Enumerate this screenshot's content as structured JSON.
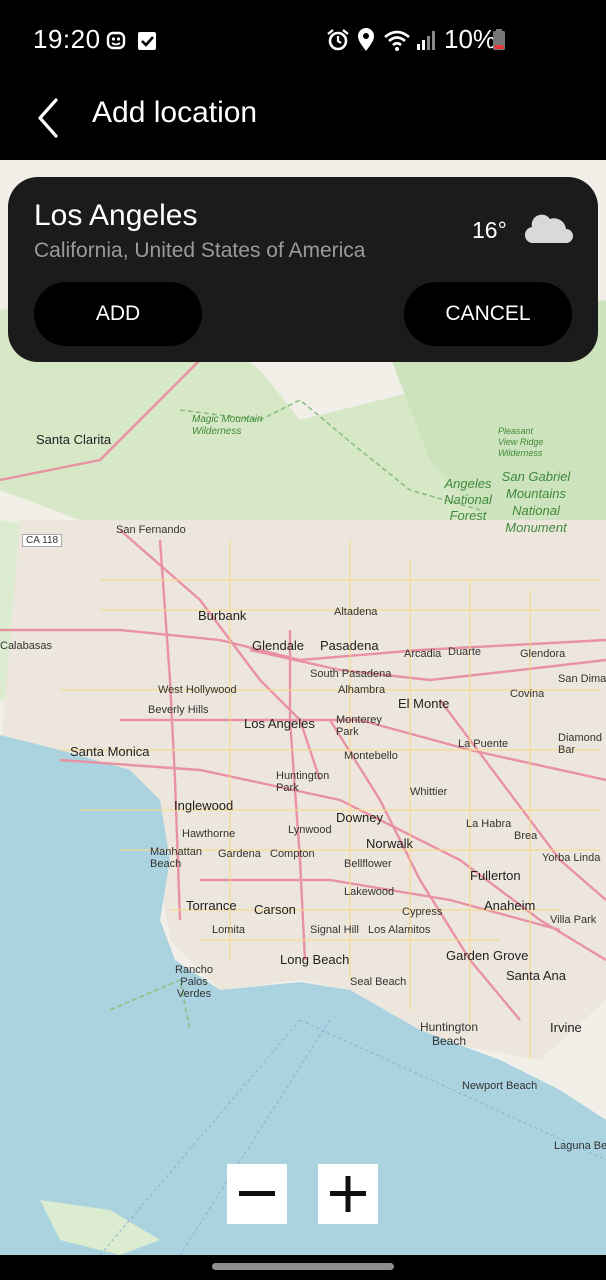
{
  "status_bar": {
    "time": "19:20",
    "battery": "10%",
    "icons": [
      "notification-icon",
      "task-icon",
      "alarm-icon",
      "location-icon",
      "wifi-icon",
      "signal-icon",
      "battery-icon"
    ]
  },
  "app_bar": {
    "back_icon": "back-arrow-icon",
    "title": "Add location"
  },
  "location_card": {
    "city": "Los Angeles",
    "region": "California, United States of America",
    "temperature": "16°",
    "weather_icon": "cloud-icon",
    "add_label": "ADD",
    "cancel_label": "CANCEL"
  },
  "map": {
    "labels": [
      {
        "text": "Santa Clarita"
      },
      {
        "text": "San Fernando"
      },
      {
        "text": "CA 118"
      },
      {
        "text": "Burbank"
      },
      {
        "text": "Glendale"
      },
      {
        "text": "Pasadena"
      },
      {
        "text": "Altadena"
      },
      {
        "text": "Arcadia"
      },
      {
        "text": "Duarte"
      },
      {
        "text": "Glendora"
      },
      {
        "text": "San Dimas"
      },
      {
        "text": "South Pasadena"
      },
      {
        "text": "West Hollywood"
      },
      {
        "text": "Beverly Hills"
      },
      {
        "text": "Alhambra"
      },
      {
        "text": "El Monte"
      },
      {
        "text": "Covina"
      },
      {
        "text": "Los Angeles"
      },
      {
        "text": "Monterey Park"
      },
      {
        "text": "Santa Monica"
      },
      {
        "text": "Montebello"
      },
      {
        "text": "La Puente"
      },
      {
        "text": "Diamond Bar"
      },
      {
        "text": "Huntington Park"
      },
      {
        "text": "Whittier"
      },
      {
        "text": "Inglewood"
      },
      {
        "text": "Downey"
      },
      {
        "text": "La Habra"
      },
      {
        "text": "Brea"
      },
      {
        "text": "Hawthorne"
      },
      {
        "text": "Lynwood"
      },
      {
        "text": "Norwalk"
      },
      {
        "text": "Manhattan Beach"
      },
      {
        "text": "Gardena"
      },
      {
        "text": "Compton"
      },
      {
        "text": "Bellflower"
      },
      {
        "text": "Yorba Linda"
      },
      {
        "text": "Fullerton"
      },
      {
        "text": "Lakewood"
      },
      {
        "text": "Torrance"
      },
      {
        "text": "Carson"
      },
      {
        "text": "Cypress"
      },
      {
        "text": "Anaheim"
      },
      {
        "text": "Villa Park"
      },
      {
        "text": "Lomita"
      },
      {
        "text": "Signal Hill"
      },
      {
        "text": "Los Alamitos"
      },
      {
        "text": "Garden Grove"
      },
      {
        "text": "Long Beach"
      },
      {
        "text": "Santa Ana"
      },
      {
        "text": "Rancho Palos Verdes"
      },
      {
        "text": "Seal Beach"
      },
      {
        "text": "Huntington Beach"
      },
      {
        "text": "Irvine"
      },
      {
        "text": "Newport Beach"
      },
      {
        "text": "Laguna Beach"
      },
      {
        "text": "Magic Mountain Wilderness"
      },
      {
        "text": "Angeles National Forest"
      },
      {
        "text": "San Gabriel Mountains National Monument"
      },
      {
        "text": "Pleasant View Ridge Wilderness"
      },
      {
        "text": "Calabasas"
      }
    ]
  },
  "zoom": {
    "out_icon": "minus-icon",
    "in_icon": "plus-icon"
  },
  "nav_bar": {
    "home_indicator": "home-indicator"
  },
  "colors": {
    "background": "#000000",
    "card": "#1b1b1b",
    "ocean": "#aad3df",
    "land": "#f2efe9",
    "forest": "#cde6c0",
    "roads": "#e892a2",
    "region_text": "#9a9a9a"
  }
}
